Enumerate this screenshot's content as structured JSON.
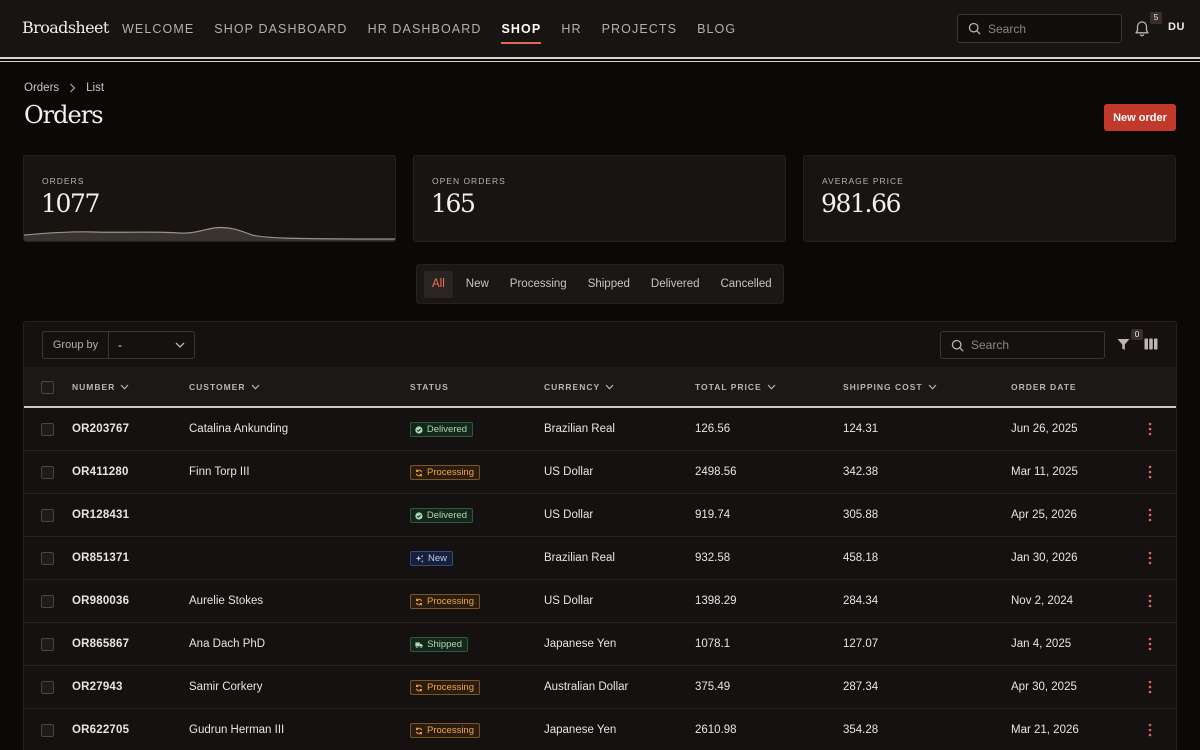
{
  "brand": "Broadsheet",
  "nav": [
    "WELCOME",
    "SHOP DASHBOARD",
    "HR DASHBOARD",
    "SHOP",
    "HR",
    "PROJECTS",
    "BLOG"
  ],
  "nav_active": "SHOP",
  "top_search": {
    "placeholder": "Search"
  },
  "notifications": {
    "count": "5"
  },
  "user": {
    "initials": "DU"
  },
  "breadcrumb": {
    "root": "Orders",
    "current": "List"
  },
  "page_title": "Orders",
  "new_order_label": "New order",
  "stats": [
    {
      "label": "ORDERS",
      "value": "1077"
    },
    {
      "label": "OPEN ORDERS",
      "value": "165"
    },
    {
      "label": "AVERAGE PRICE",
      "value": "981.66"
    }
  ],
  "tabs": [
    "All",
    "New",
    "Processing",
    "Shipped",
    "Delivered",
    "Cancelled"
  ],
  "active_tab": "All",
  "group_by": {
    "label": "Group by",
    "value": "-"
  },
  "table_search": {
    "placeholder": "Search"
  },
  "filter_count": "0",
  "columns": {
    "number": "NUMBER",
    "customer": "CUSTOMER",
    "status": "STATUS",
    "currency": "CURRENCY",
    "total_price": "TOTAL PRICE",
    "shipping_cost": "SHIPPING COST",
    "order_date": "ORDER DATE"
  },
  "rows": [
    {
      "number": "OR203767",
      "customer": "Catalina Ankunding",
      "status": "Delivered",
      "currency": "Brazilian Real",
      "total": "126.56",
      "shipping": "124.31",
      "date": "Jun 26, 2025"
    },
    {
      "number": "OR411280",
      "customer": "Finn Torp III",
      "status": "Processing",
      "currency": "US Dollar",
      "total": "2498.56",
      "shipping": "342.38",
      "date": "Mar 11, 2025"
    },
    {
      "number": "OR128431",
      "customer": "",
      "status": "Delivered",
      "currency": "US Dollar",
      "total": "919.74",
      "shipping": "305.88",
      "date": "Apr 25, 2026"
    },
    {
      "number": "OR851371",
      "customer": "",
      "status": "New",
      "currency": "Brazilian Real",
      "total": "932.58",
      "shipping": "458.18",
      "date": "Jan 30, 2026"
    },
    {
      "number": "OR980036",
      "customer": "Aurelie Stokes",
      "status": "Processing",
      "currency": "US Dollar",
      "total": "1398.29",
      "shipping": "284.34",
      "date": "Nov 2, 2024"
    },
    {
      "number": "OR865867",
      "customer": "Ana Dach PhD",
      "status": "Shipped",
      "currency": "Japanese Yen",
      "total": "1078.1",
      "shipping": "127.07",
      "date": "Jan 4, 2025"
    },
    {
      "number": "OR27943",
      "customer": "Samir Corkery",
      "status": "Processing",
      "currency": "Australian Dollar",
      "total": "375.49",
      "shipping": "287.34",
      "date": "Apr 30, 2025"
    },
    {
      "number": "OR622705",
      "customer": "Gudrun Herman III",
      "status": "Processing",
      "currency": "Japanese Yen",
      "total": "2610.98",
      "shipping": "354.28",
      "date": "Mar 21, 2026"
    }
  ],
  "colors": {
    "accent": "#c0392b",
    "active_tab_text": "#ec6f60",
    "background": "#0b0908"
  }
}
